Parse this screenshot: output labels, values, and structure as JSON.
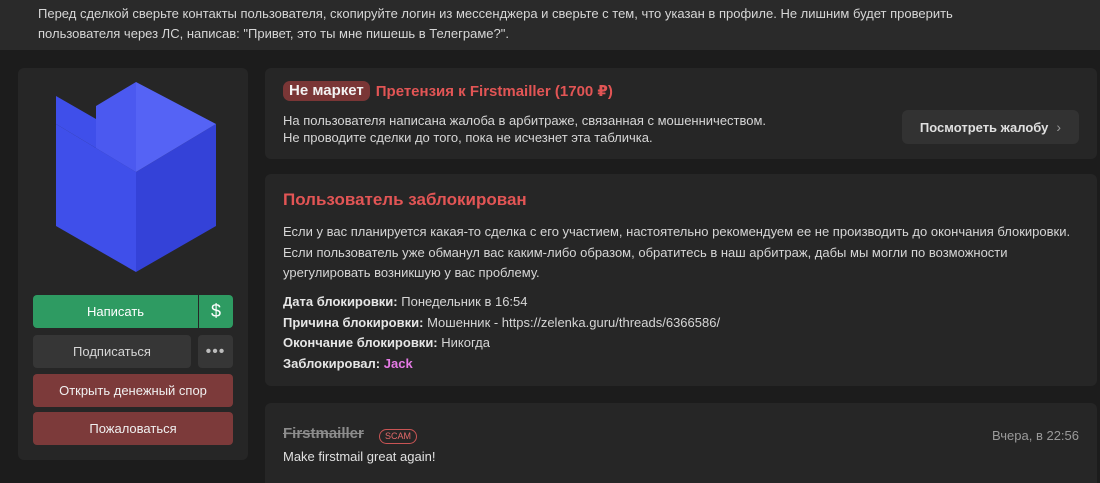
{
  "notice": {
    "line1": "Перед сделкой сверьте контакты пользователя, скопируйте логин из мессенджера и сверьте с тем, что указан в профиле. Не лишним будет проверить",
    "line2": "пользователя через ЛС, написав: \"Привет, это ты мне пишешь в Телеграме?\"."
  },
  "actions": {
    "write": "Написать",
    "dollar": "$",
    "subscribe": "Подписаться",
    "more": "•••",
    "dispute": "Открыть денежный спор",
    "report": "Пожаловаться"
  },
  "claim": {
    "badge": "Не маркет",
    "title": "Претензия к Firstmailler (1700 ₽)",
    "line1": "На пользователя написана жалоба в арбитраже, связанная с мошенничеством.",
    "line2": "Не проводите сделки до того, пока не исчезнет эта табличка.",
    "view_button": "Посмотреть жалобу",
    "view_chevron": "›"
  },
  "block": {
    "title": "Пользователь заблокирован",
    "description": "Если у вас планируется какая-то сделка с его участием, настоятельно рекомендуем ее не производить до окончания блокировки. Если пользователь уже обманул вас каким-либо образом, обратитесь в наш арбитраж, дабы мы могли по возможности урегулировать возникшую у вас проблему.",
    "date_label": "Дата блокировки:",
    "date_value": "Понедельник в 16:54",
    "reason_label": "Причина блокировки:",
    "reason_value": "Мошенник - https://zelenka.guru/threads/6366586/",
    "end_label": "Окончание блокировки:",
    "end_value": "Никогда",
    "by_label": "Заблокировал:",
    "by_value": "Jack"
  },
  "profile": {
    "username": "Firstmailler",
    "badge": "SCAM",
    "date": "Вчера, в 22:56",
    "status": "Make firstmail great again!"
  },
  "colors": {
    "green": "#2e9b62",
    "red_button": "#7c3a3a",
    "red_text": "#e25555",
    "avatar_blue": "#4e5cf2",
    "moderator_pink": "#e57ae5"
  }
}
